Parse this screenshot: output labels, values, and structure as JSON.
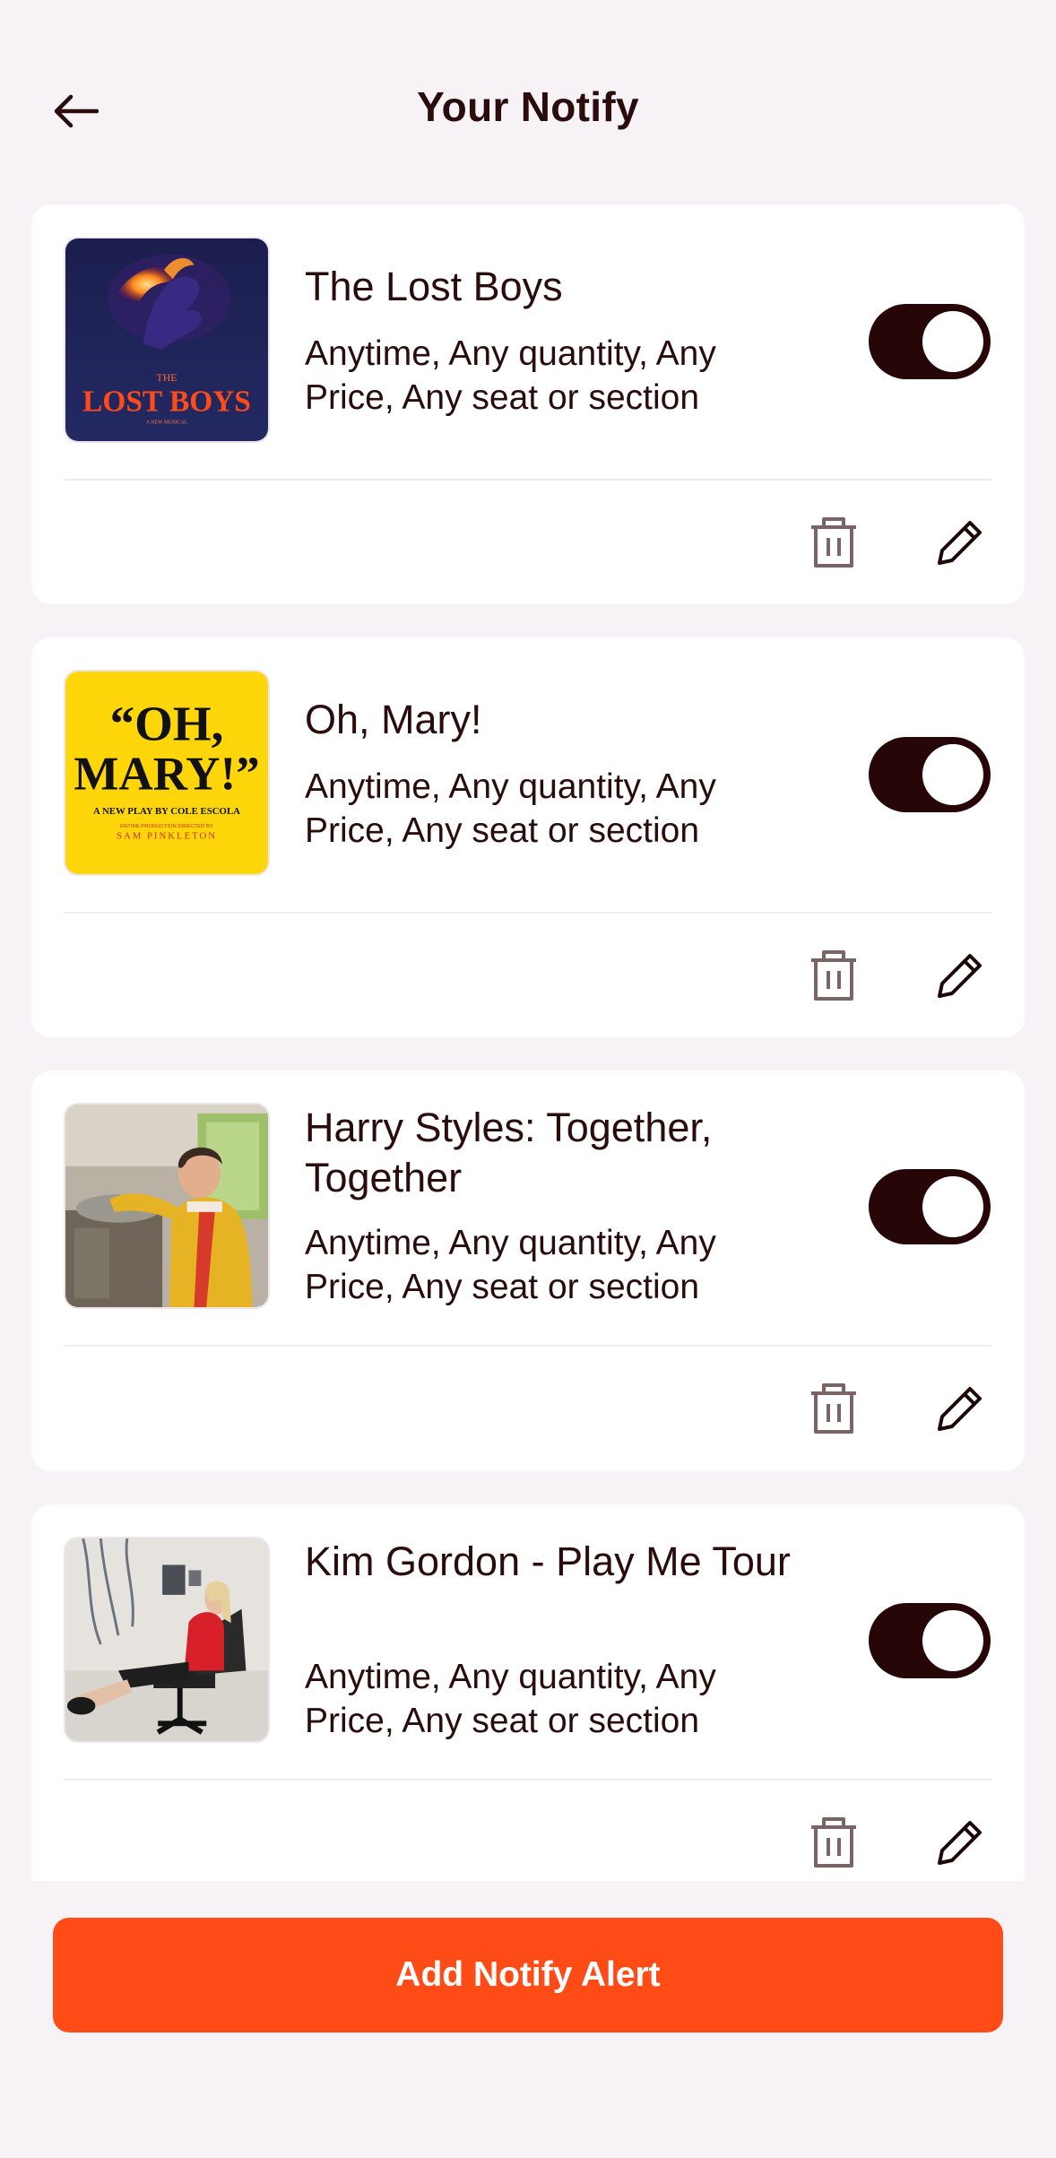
{
  "header": {
    "title": "Your Notify",
    "back_icon": "arrow-left-icon"
  },
  "alerts": [
    {
      "title": "The Lost Boys",
      "description": "Anytime, Any quantity, Any Price, Any seat or section",
      "enabled": true,
      "poster_lettering": [
        "THE",
        "LOST BOYS",
        "A NEW MUSICAL"
      ]
    },
    {
      "title": "Oh, Mary!",
      "description": "Anytime, Any quantity, Any Price, Any seat or section",
      "enabled": true,
      "poster_lettering": [
        "“OH,",
        "MARY!”",
        "A NEW PLAY BY COLE ESCOLA",
        "ENTIRE PRODUCTION DIRECTED BY",
        "SAM PINKLETON"
      ]
    },
    {
      "title": "Harry Styles: Together, Together",
      "description": "Anytime, Any quantity, Any Price, Any seat or section",
      "enabled": true
    },
    {
      "title": "Kim Gordon - Play Me Tour",
      "description": "Anytime, Any quantity, Any Price, Any seat or section",
      "enabled": true
    }
  ],
  "actions": {
    "delete_icon": "trash-icon",
    "edit_icon": "pencil-icon"
  },
  "footer": {
    "add_button_label": "Add Notify Alert"
  },
  "colors": {
    "background": "#f6f2f6",
    "card": "#ffffff",
    "text": "#2a0c0c",
    "toggle_on": "#260606",
    "accent": "#ff4b16",
    "icon_muted": "#7a6466"
  }
}
